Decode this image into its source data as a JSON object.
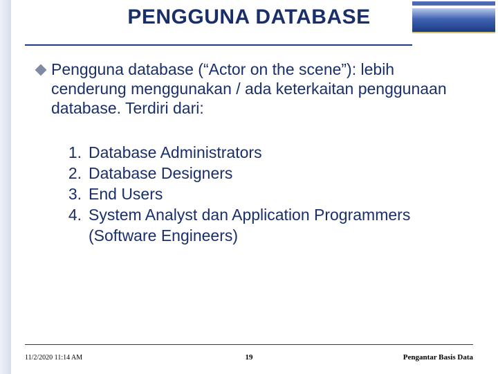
{
  "title": "PENGGUNA DATABASE",
  "bullet": {
    "icon_name": "diamond-icon",
    "text": "Pengguna database (“Actor on the scene”): lebih cenderung menggunakan / ada keterkaitan penggunaan database. Terdiri dari:"
  },
  "list": [
    {
      "num": "1.",
      "text": "Database Administrators"
    },
    {
      "num": "2.",
      "text": "Database Designers"
    },
    {
      "num": "3.",
      "text": "End Users"
    },
    {
      "num": "4.",
      "text": "System Analyst dan Application Programmers (Software Engineers)"
    }
  ],
  "footer": {
    "timestamp": "11/2/2020 11:14 AM",
    "page_number": "19",
    "course": "Pengantar Basis Data"
  },
  "colors": {
    "heading": "#1a2f6a",
    "rule": "#1d3a86"
  }
}
